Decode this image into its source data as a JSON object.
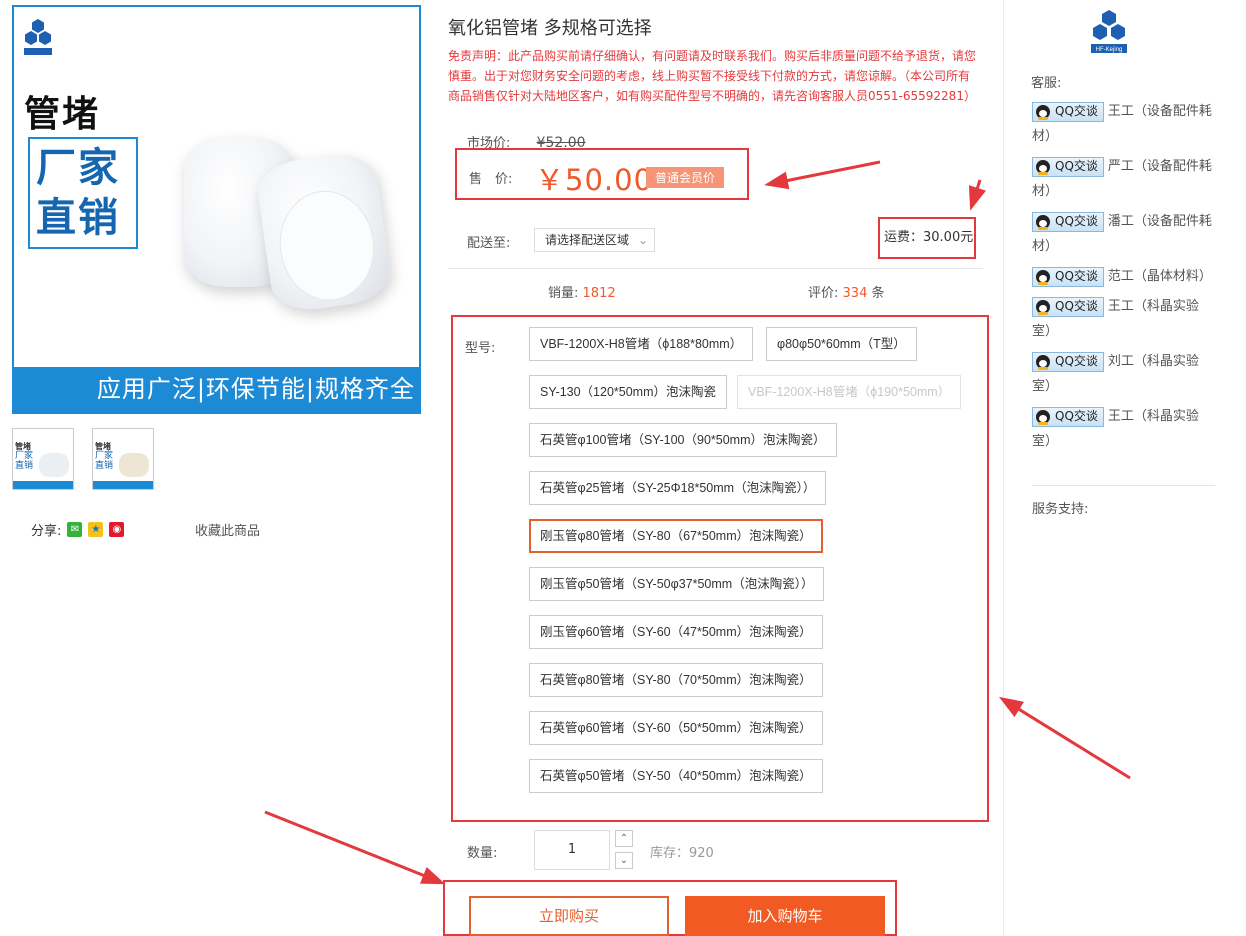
{
  "gallery": {
    "image_title": "管堵",
    "image_box_lines": [
      "厂家",
      "直销"
    ],
    "image_banner": "应用广泛|环保节能|规格齐全",
    "logo_text": "HF-Kejing",
    "thumbs": [
      {
        "title": "管堵",
        "box": "厂家直销"
      },
      {
        "title": "管堵",
        "box": "厂家直销"
      }
    ]
  },
  "share": {
    "label": "分享:",
    "icons": [
      "wechat-icon",
      "qzone-icon",
      "weibo-icon"
    ],
    "favorite_label": "收藏此商品"
  },
  "product": {
    "title": "氧化铝管堵 多规格可选择",
    "disclaimer": "免责声明：此产品购买前请仔细确认，有问题请及时联系我们。购买后非质量问题不给予退货，请您慎重。出于对您财务安全问题的考虑，线上购买暂不接受线下付款的方式，请您谅解。（本公司所有商品销售仅针对大陆地区客户，如有购买配件型号不明确的，请先咨询客服人员0551-65592281）",
    "market_label": "市场价:",
    "market_price": "¥52.00",
    "price_label": "售　价:",
    "price": "￥50.00",
    "member_tag": "普通会员价",
    "ship_label": "配送至:",
    "ship_select": "请选择配送区域",
    "freight": "运费：30.00元",
    "sales_label": "销量:",
    "sales_value": "1812",
    "rating_label": "评价:",
    "rating_value": "334",
    "rating_unit": "条"
  },
  "spec": {
    "label": "型号:",
    "options": [
      {
        "label": "VBF-1200X-H8管堵（ϕ188*80mm）",
        "state": "normal"
      },
      {
        "label": "φ80φ50*60mm（T型）",
        "state": "normal"
      },
      {
        "label": "SY-130（120*50mm）泡沫陶瓷",
        "state": "normal"
      },
      {
        "label": "VBF-1200X-H8管堵（ϕ190*50mm）",
        "state": "disabled"
      },
      {
        "label": "石英管φ100管堵（SY-100（90*50mm）泡沫陶瓷）",
        "state": "normal"
      },
      {
        "label": "石英管φ25管堵（SY-25Φ18*50mm（泡沫陶瓷））",
        "state": "normal"
      },
      {
        "label": "刚玉管φ80管堵（SY-80（67*50mm）泡沫陶瓷）",
        "state": "selected"
      },
      {
        "label": "刚玉管φ50管堵（SY-50φ37*50mm（泡沫陶瓷））",
        "state": "normal"
      },
      {
        "label": "刚玉管φ60管堵（SY-60（47*50mm）泡沫陶瓷）",
        "state": "normal"
      },
      {
        "label": "石英管φ80管堵（SY-80（70*50mm）泡沫陶瓷）",
        "state": "normal"
      },
      {
        "label": "石英管φ60管堵（SY-60（50*50mm）泡沫陶瓷）",
        "state": "normal"
      },
      {
        "label": "石英管φ50管堵（SY-50（40*50mm）泡沫陶瓷）",
        "state": "normal"
      }
    ]
  },
  "purchase": {
    "qty_label": "数量:",
    "qty_value": "1",
    "stock": "库存：920",
    "buy_now": "立即购买",
    "add_cart": "加入购物车"
  },
  "service": {
    "cs_label": "客服:",
    "qq_label": "QQ交谈",
    "agents": [
      {
        "name": "王工（设备配件耗材）"
      },
      {
        "name": "严工（设备配件耗材）"
      },
      {
        "name": "潘工（设备配件耗材）"
      },
      {
        "name": "范工（晶体材料）"
      },
      {
        "name": "王工（科晶实验室）"
      },
      {
        "name": "刘工（科晶实验室）"
      },
      {
        "name": "王工（科晶实验室）"
      }
    ],
    "support_label": "服务支持:"
  },
  "colors": {
    "accent": "#f25a23",
    "annotation_red": "#e4393c",
    "brand_blue": "#1c8ad4"
  }
}
